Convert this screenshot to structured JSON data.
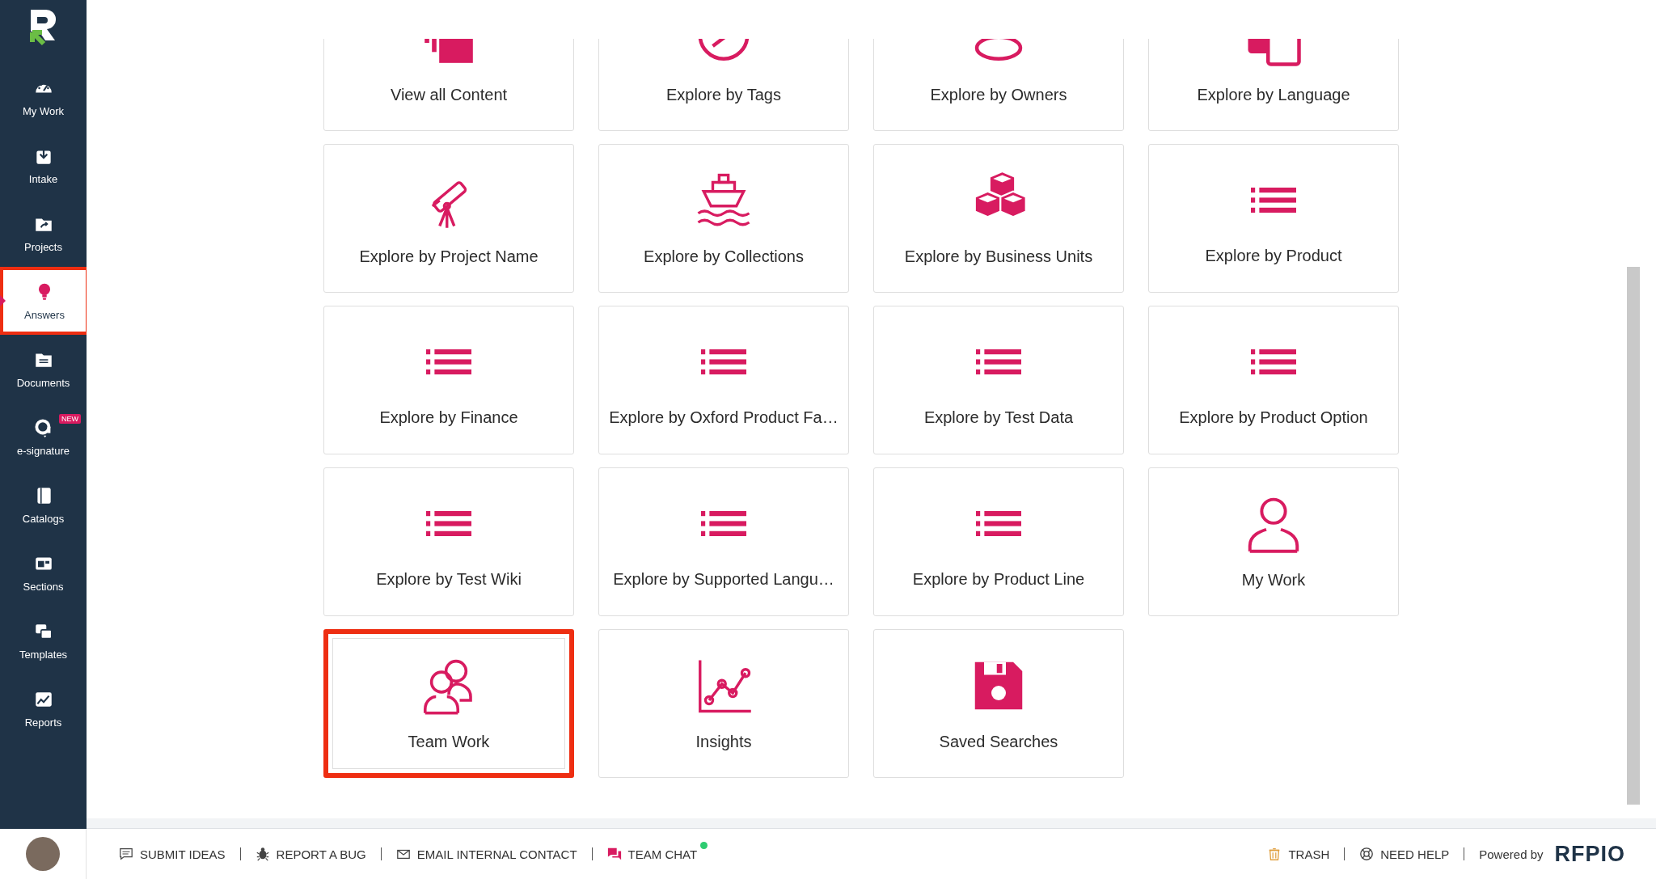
{
  "sidebar": {
    "items": [
      {
        "label": "My Work",
        "kind": "gauge",
        "selected": false,
        "highlighted": false
      },
      {
        "label": "Intake",
        "kind": "inbox",
        "selected": false,
        "highlighted": false
      },
      {
        "label": "Projects",
        "kind": "folder",
        "selected": false,
        "highlighted": false
      },
      {
        "label": "Answers",
        "kind": "bulb",
        "selected": true,
        "highlighted": true
      },
      {
        "label": "Documents",
        "kind": "docs",
        "selected": false,
        "highlighted": false
      },
      {
        "label": "e-signature",
        "kind": "sign",
        "selected": false,
        "highlighted": false,
        "badge": "NEW"
      },
      {
        "label": "Catalogs",
        "kind": "book",
        "selected": false,
        "highlighted": false
      },
      {
        "label": "Sections",
        "kind": "window",
        "selected": false,
        "highlighted": false
      },
      {
        "label": "Templates",
        "kind": "stack",
        "selected": false,
        "highlighted": false
      },
      {
        "label": "Reports",
        "kind": "report",
        "selected": false,
        "highlighted": false
      }
    ]
  },
  "cards": [
    {
      "label": "View all Content",
      "kind": "layers",
      "highlighted": false
    },
    {
      "label": "Explore by Tags",
      "kind": "tag",
      "highlighted": false
    },
    {
      "label": "Explore by Owners",
      "kind": "owner",
      "highlighted": false
    },
    {
      "label": "Explore by Language",
      "kind": "language",
      "highlighted": false
    },
    {
      "label": "Explore by Project Name",
      "kind": "telescope",
      "highlighted": false
    },
    {
      "label": "Explore by Collections",
      "kind": "ship",
      "highlighted": false
    },
    {
      "label": "Explore by Business Units",
      "kind": "cubes",
      "highlighted": false
    },
    {
      "label": "Explore by Product",
      "kind": "list",
      "highlighted": false
    },
    {
      "label": "Explore by Finance",
      "kind": "list",
      "highlighted": false
    },
    {
      "label": "Explore by Oxford Product Fa…",
      "kind": "list",
      "highlighted": false
    },
    {
      "label": "Explore by Test Data",
      "kind": "list",
      "highlighted": false
    },
    {
      "label": "Explore by Product Option",
      "kind": "list",
      "highlighted": false
    },
    {
      "label": "Explore by Test Wiki",
      "kind": "list",
      "highlighted": false
    },
    {
      "label": "Explore by Supported Langu…",
      "kind": "list",
      "highlighted": false
    },
    {
      "label": "Explore by Product Line",
      "kind": "list",
      "highlighted": false
    },
    {
      "label": "My Work",
      "kind": "person",
      "highlighted": false
    },
    {
      "label": "Team Work",
      "kind": "people",
      "highlighted": true
    },
    {
      "label": "Insights",
      "kind": "chart",
      "highlighted": false
    },
    {
      "label": "Saved Searches",
      "kind": "save",
      "highlighted": false
    }
  ],
  "footer": {
    "links": [
      {
        "label": "SUBMIT IDEAS",
        "kind": "comment"
      },
      {
        "label": "REPORT A BUG",
        "kind": "bug"
      },
      {
        "label": "EMAIL INTERNAL CONTACT",
        "kind": "mail"
      },
      {
        "label": "TEAM CHAT",
        "kind": "chat",
        "online": true
      }
    ],
    "right_links": [
      {
        "label": "TRASH",
        "kind": "trash"
      },
      {
        "label": "NEED HELP",
        "kind": "help"
      }
    ],
    "powered_by": "Powered by",
    "logo": "RFPIO"
  }
}
